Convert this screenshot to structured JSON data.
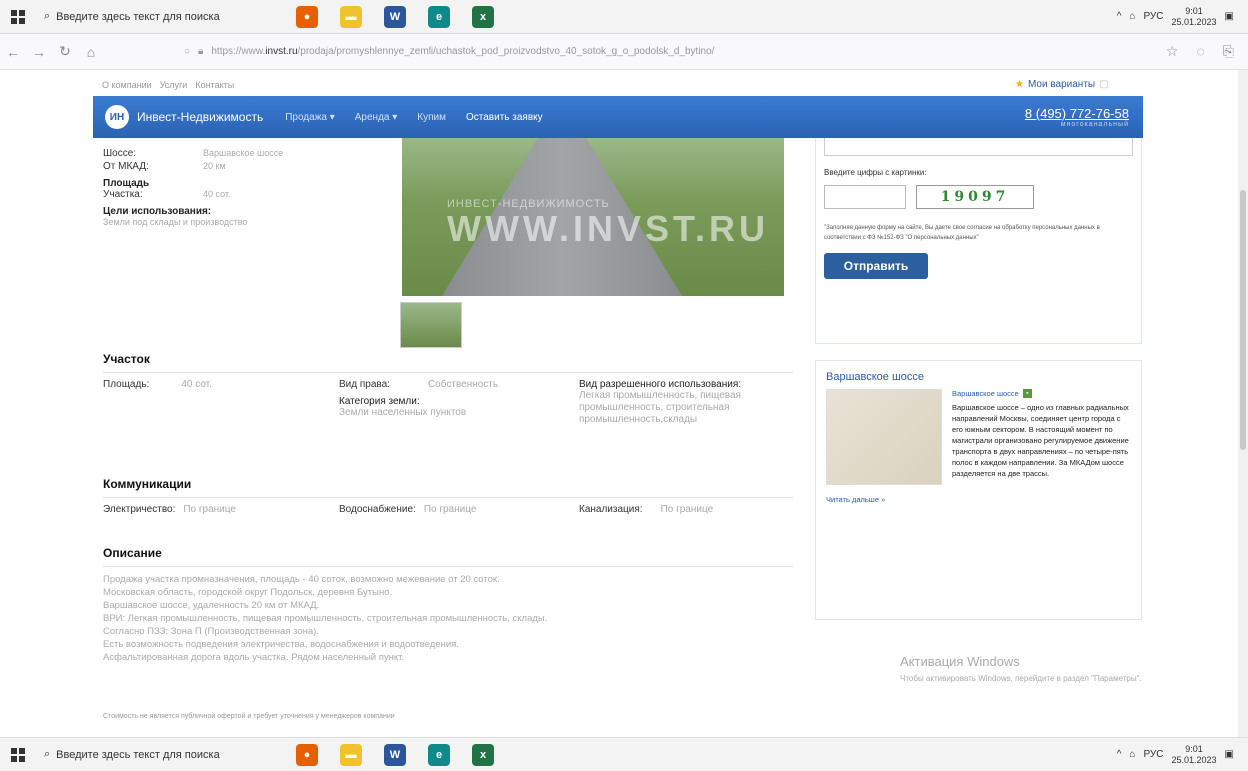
{
  "taskbar": {
    "search_placeholder": "Введите здесь текст для поиска",
    "lang": "РУС",
    "time": "9:01",
    "date": "25.01.2023",
    "apps": [
      "firefox",
      "files",
      "word",
      "edge",
      "excel"
    ]
  },
  "browser": {
    "url_prefix": "https://www.",
    "url_domain": "invst.ru",
    "url_path": "/prodaja/promyshlennye_zemli/uchastok_pod_proizvodstvo_40_sotok_g_o_podolsk_d_bytino/"
  },
  "site": {
    "top_links": [
      "О компании",
      "Услуги",
      "Контакты"
    ],
    "favorites": "Мои варианты",
    "logo_mark": "ИН",
    "logo_text": "Инвест-Недвижимость",
    "nav": [
      "Продажа ▾",
      "Аренда ▾",
      "Купим"
    ],
    "nav_cta": "Оставить заявку",
    "phone": "8 (495) 772-76-58",
    "phone_sub": "многоканальный"
  },
  "specs": {
    "shosse_label": "Шоссе:",
    "shosse_value": "Варшавское шоссе",
    "mkad_label": "От МКАД:",
    "mkad_value": "20 км",
    "area_head": "Площадь",
    "plot_label": "Участка:",
    "plot_value": "40 сот.",
    "use_head": "Цели использования:",
    "use_value": "Земли под склады и производство"
  },
  "photo": {
    "wm_small": "ИНВЕСТ-НЕДВИЖИМОСТЬ",
    "wm_big": "WWW.INVST.RU"
  },
  "uchastok": {
    "title": "Участок",
    "area_label": "Площадь:",
    "area_value": "40 сот.",
    "right_label": "Вид права:",
    "right_value": "Собственность",
    "cat_label": "Категория земли:",
    "cat_value": "Земли населенных пунктов",
    "vri_label": "Вид разрешенного использования:",
    "vri_value": "Легкая промышленность, пищевая промышленность, строительная промышленность,склады"
  },
  "comm": {
    "title": "Коммуникации",
    "elec_label": "Электричество:",
    "elec_value": "По границе",
    "water_label": "Водоснабжение:",
    "water_value": "По границе",
    "sewer_label": "Канализация:",
    "sewer_value": "По границе"
  },
  "description": {
    "title": "Описание",
    "lines": [
      "Продажа участка промназначения, площадь - 40 соток, возможно межевание от 20 соток.",
      "Московская область, городской округ Подольск, деревня Бутыно.",
      "Варшавское шоссе, удаленность 20 км от МКАД.",
      "ВРИ: Легкая промышленность, пищевая промышленность, строительная промышленность, склады.",
      "Согласно ПЗЗ: Зона П (Производственная зона).",
      "Есть возможность подведения электричества, водоснабжения и водоотведения.",
      "Асфальтированная дорога вдоль участка. Рядом населенный пункт."
    ],
    "note": "Стоимость не является публичной офертой и требует уточнения у менеджеров компании"
  },
  "form": {
    "captcha_label": "Введите цифры с картинки:",
    "captcha_code": "19097",
    "consent": "\"Заполняя данную форму на сайте, Вы даете свое согласие на обработку персональных данных в соответствии с ФЗ №152-ФЗ \"О персональных данных\"",
    "submit": "Отправить"
  },
  "wiki": {
    "title": "Варшавское шоссе",
    "link": "Варшавское шоссе",
    "text": "Варшавское шоссе – одно из главных радиальных направлений Москвы, соединяет центр города с его южным сектором. В настоящий момент по магистрали организовано регулируемое движение транспорта в двух направлениях – по четыре-пять полос в каждом направлении. За МКАДом шоссе разделяется на две трассы.",
    "more": "Читать дальше »"
  },
  "windows": {
    "activate_title": "Активация Windows",
    "activate_text": "Чтобы активировать Windows, перейдите в раздел \"Параметры\"."
  },
  "colors": {
    "nav_blue": "#2b62b3",
    "button_blue": "#2b5f9e",
    "link_blue": "#2a5ba8"
  }
}
